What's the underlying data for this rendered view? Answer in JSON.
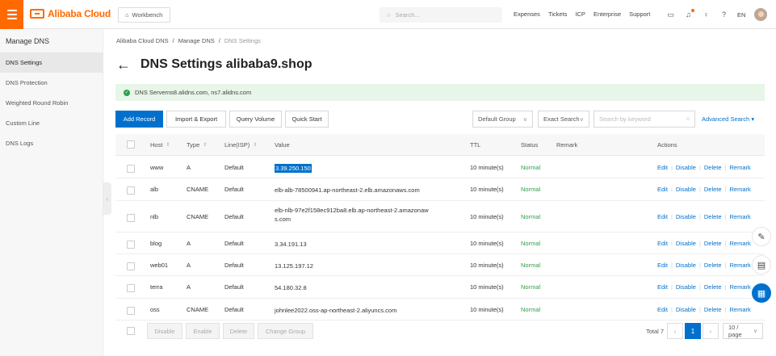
{
  "topbar": {
    "logo_text": "Alibaba Cloud",
    "workbench": "Workbench",
    "search_placeholder": "Search...",
    "links": [
      "Expenses",
      "Tickets",
      "ICP",
      "Enterprise",
      "Support"
    ],
    "lang": "EN",
    "accent": "#ff6a00"
  },
  "sidebar": {
    "title": "Manage DNS",
    "items": [
      {
        "label": "DNS Settings",
        "active": true
      },
      {
        "label": "DNS Protection"
      },
      {
        "label": "Weighted Round Robin"
      },
      {
        "label": "Custom Line"
      },
      {
        "label": "DNS Logs"
      }
    ]
  },
  "breadcrumb": [
    "Alibaba Cloud DNS",
    "Manage DNS",
    "DNS Settings"
  ],
  "page": {
    "title": "DNS Settings alibaba9.shop",
    "notice": "DNS Serverns8.alidns.com, ns7.alidns.com"
  },
  "toolbar": {
    "add": "Add Record",
    "import": "Import & Export",
    "query": "Query Volume",
    "quick": "Quick Start",
    "group": "Default Group",
    "search_mode": "Exact Search",
    "keyword_placeholder": "Search by keyword",
    "advanced": "Advanced Search"
  },
  "table": {
    "headers": {
      "host": "Host",
      "type": "Type",
      "line": "Line(ISP)",
      "value": "Value",
      "ttl": "TTL",
      "status": "Status",
      "remark": "Remark",
      "actions": "Actions"
    },
    "rows": [
      {
        "host": "www",
        "type": "A",
        "line": "Default",
        "value": "3.39.250.150",
        "ttl": "10 minute(s)",
        "status": "Normal"
      },
      {
        "host": "alb",
        "type": "CNAME",
        "line": "Default",
        "value": "elb-alb-78500941.ap-northeast-2.elb.amazonaws.com",
        "ttl": "10 minute(s)",
        "status": "Normal"
      },
      {
        "host": "nlb",
        "type": "CNAME",
        "line": "Default",
        "value": "elb-nlb-97e2f158ec912ba8.elb.ap-northeast-2.amazonaws.com",
        "ttl": "10 minute(s)",
        "status": "Normal"
      },
      {
        "host": "blog",
        "type": "A",
        "line": "Default",
        "value": "3.34.191.13",
        "ttl": "10 minute(s)",
        "status": "Normal"
      },
      {
        "host": "web01",
        "type": "A",
        "line": "Default",
        "value": "13.125.197.12",
        "ttl": "10 minute(s)",
        "status": "Normal"
      },
      {
        "host": "terra",
        "type": "A",
        "line": "Default",
        "value": "54.180.32.8",
        "ttl": "10 minute(s)",
        "status": "Normal"
      },
      {
        "host": "oss",
        "type": "CNAME",
        "line": "Default",
        "value": "johnlee2022.oss-ap-northeast-2.aliyuncs.com",
        "ttl": "10 minute(s)",
        "status": "Normal"
      }
    ],
    "actions": [
      "Edit",
      "Disable",
      "Delete",
      "Remark"
    ]
  },
  "footer": {
    "disable": "Disable",
    "enable": "Enable",
    "delete": "Delete",
    "change_group": "Change Group",
    "total": "Total 7",
    "page": "1",
    "page_size": "10 / page"
  }
}
